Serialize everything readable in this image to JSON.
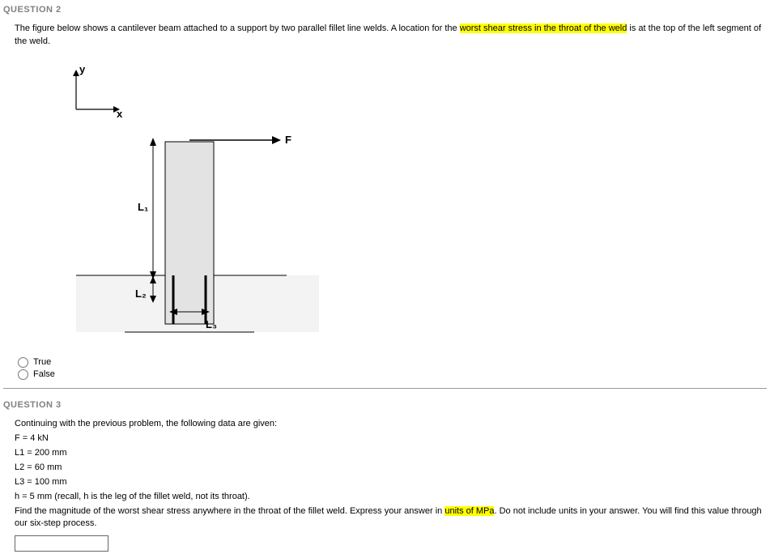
{
  "q2": {
    "header": "QUESTION 2",
    "text_before": "The figure below shows a cantilever beam attached to a support by two parallel fillet line welds. A location for the ",
    "text_highlight": "worst shear stress in the throat of the weld",
    "text_after": " is at the top of the left segment of the weld.",
    "figure": {
      "axis_y": "y",
      "axis_x": "x",
      "force": "F",
      "L1": "L₁",
      "L2": "L₂",
      "L3": "L₃"
    },
    "opt_true": "True",
    "opt_false": "False"
  },
  "q3": {
    "header": "QUESTION 3",
    "lead": "Continuing with the previous problem, the following data are given:",
    "d1": "F = 4 kN",
    "d2": "L1 = 200 mm",
    "d3": "L2 = 60 mm",
    "d4": "L3 = 100 mm",
    "d5": "h = 5 mm  (recall, h is the leg of the fillet weld, not its throat).",
    "find_before": "Find the magnitude of the worst shear stress anywhere in the throat of the fillet weld.  Express your answer in ",
    "find_highlight": "units of MPa",
    "find_after": ".  Do not include units in your answer.  You will find this value through our six-step process."
  }
}
